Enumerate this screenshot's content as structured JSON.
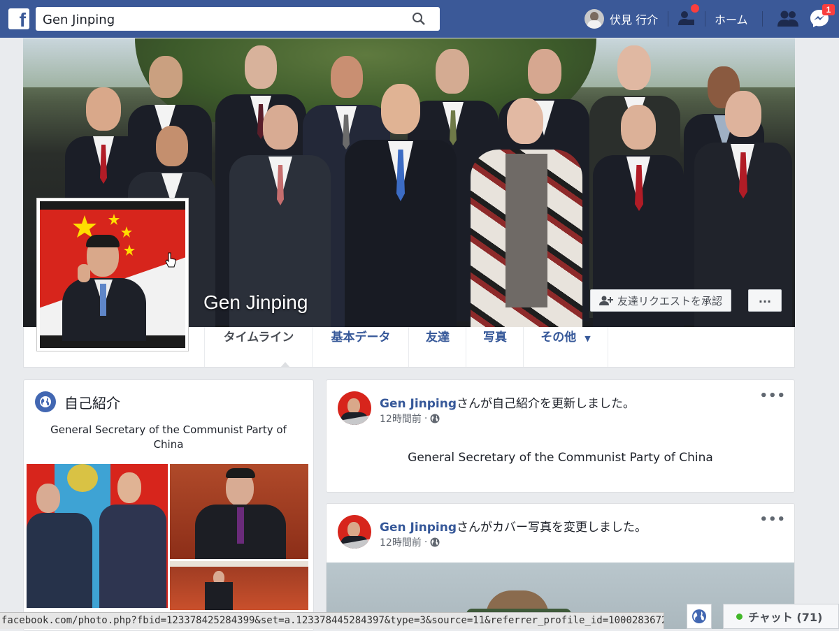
{
  "topbar": {
    "logo": "f",
    "search_value": "Gen Jinping",
    "user_name": "伏見 行介",
    "home_label": "ホーム",
    "messages_count": "1",
    "icons": [
      "search-icon",
      "friend-requests-icon",
      "friends-icon",
      "messenger-icon"
    ]
  },
  "profile": {
    "name": "Gen Jinping",
    "friend_request_button": "友達リクエストを承認",
    "more_button": "..."
  },
  "tabs": [
    {
      "label": "タイムライン"
    },
    {
      "label": "基本データ"
    },
    {
      "label": "友達"
    },
    {
      "label": "写真"
    },
    {
      "label": "その他"
    }
  ],
  "intro": {
    "title": "自己紹介",
    "bio": "General Secretary of the Communist Party of China"
  },
  "posts": [
    {
      "name": "Gen Jinping",
      "action": "さんが自己紹介を更新しました。",
      "time": "12時間前",
      "text": "General Secretary of the Communist Party of China"
    },
    {
      "name": "Gen Jinping",
      "action": "さんがカバー写真を変更しました。",
      "time": "12時間前"
    }
  ],
  "status_url": "facebook.com/photo.php?fbid=123378425284399&set=a.123378445284397&type=3&source=11&referrer_profile_id=100028367253666",
  "chat": {
    "label": "チャット (71)"
  },
  "colors": {
    "brand": "#3b5998",
    "link": "#365899",
    "online": "#42b72a",
    "badge": "#fa3e3e"
  }
}
